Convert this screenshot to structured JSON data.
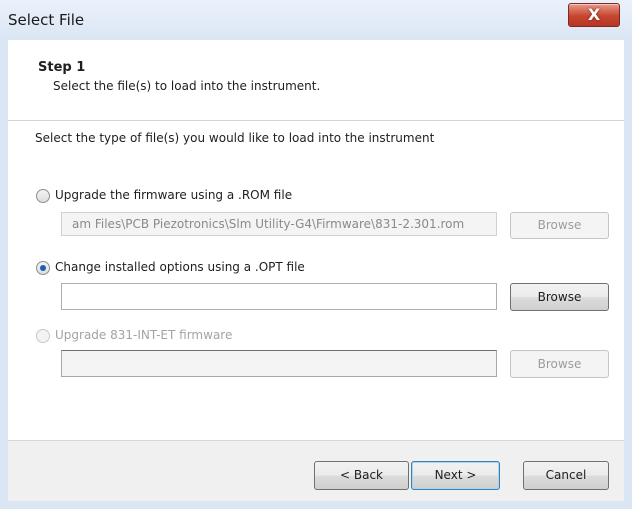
{
  "window": {
    "title": "Select File",
    "close_glyph": "X"
  },
  "header": {
    "step_title": "Step 1",
    "step_description": "Select the file(s) to load into the instrument."
  },
  "instruction": "Select the type of file(s) you would like to load into the instrument",
  "options": [
    {
      "label": "Upgrade the firmware using a .ROM file",
      "checked": false,
      "enabled": true,
      "path_value": "am Files\\PCB Piezotronics\\Slm Utility-G4\\Firmware\\831-2.301.rom",
      "path_enabled": false,
      "browse_label": "Browse",
      "browse_enabled": false
    },
    {
      "label": "Change installed options using a .OPT file",
      "checked": true,
      "enabled": true,
      "path_value": "",
      "path_enabled": true,
      "browse_label": "Browse",
      "browse_enabled": true
    },
    {
      "label": "Upgrade 831-INT-ET firmware",
      "checked": false,
      "enabled": false,
      "path_value": "",
      "path_enabled": false,
      "browse_label": "Browse",
      "browse_enabled": false
    }
  ],
  "footer": {
    "back_label": "< Back",
    "next_label": "Next >",
    "cancel_label": "Cancel"
  },
  "colors": {
    "accent": "#1a5fb4",
    "close_button": "#c6462f",
    "title_bar": "#dbe6f4"
  },
  "icons": {
    "close": "close-icon",
    "radio": "radio-button"
  }
}
